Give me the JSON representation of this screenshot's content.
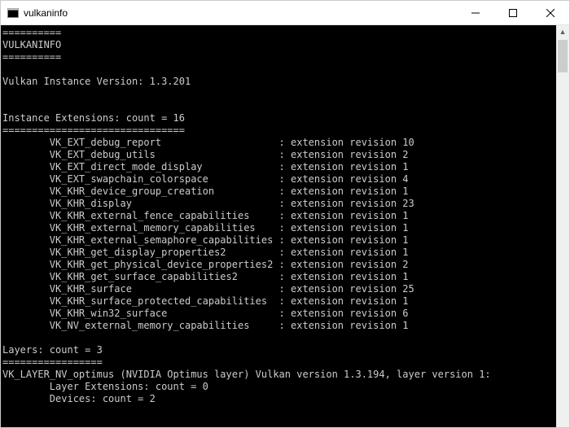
{
  "window": {
    "title": "vulkaninfo"
  },
  "header": {
    "divider": "==========",
    "title": "VULKANINFO",
    "divider2": "=========="
  },
  "instanceVersionLine": "Vulkan Instance Version: 1.3.201",
  "instanceExtensions": {
    "heading": "Instance Extensions: count = 16",
    "divider": "===============================",
    "items": [
      {
        "name": "VK_EXT_debug_report",
        "rev": "extension revision 10"
      },
      {
        "name": "VK_EXT_debug_utils",
        "rev": "extension revision 2"
      },
      {
        "name": "VK_EXT_direct_mode_display",
        "rev": "extension revision 1"
      },
      {
        "name": "VK_EXT_swapchain_colorspace",
        "rev": "extension revision 4"
      },
      {
        "name": "VK_KHR_device_group_creation",
        "rev": "extension revision 1"
      },
      {
        "name": "VK_KHR_display",
        "rev": "extension revision 23"
      },
      {
        "name": "VK_KHR_external_fence_capabilities",
        "rev": "extension revision 1"
      },
      {
        "name": "VK_KHR_external_memory_capabilities",
        "rev": "extension revision 1"
      },
      {
        "name": "VK_KHR_external_semaphore_capabilities",
        "rev": "extension revision 1"
      },
      {
        "name": "VK_KHR_get_display_properties2",
        "rev": "extension revision 1"
      },
      {
        "name": "VK_KHR_get_physical_device_properties2",
        "rev": "extension revision 2"
      },
      {
        "name": "VK_KHR_get_surface_capabilities2",
        "rev": "extension revision 1"
      },
      {
        "name": "VK_KHR_surface",
        "rev": "extension revision 25"
      },
      {
        "name": "VK_KHR_surface_protected_capabilities",
        "rev": "extension revision 1"
      },
      {
        "name": "VK_KHR_win32_surface",
        "rev": "extension revision 6"
      },
      {
        "name": "VK_NV_external_memory_capabilities",
        "rev": "extension revision 1"
      }
    ]
  },
  "layers": {
    "heading": "Layers: count = 3",
    "divider": "=================",
    "layer0": "VK_LAYER_NV_optimus (NVIDIA Optimus layer) Vulkan version 1.3.194, layer version 1:",
    "layerExt": "Layer Extensions: count = 0",
    "devices": "Devices: count = 2"
  }
}
